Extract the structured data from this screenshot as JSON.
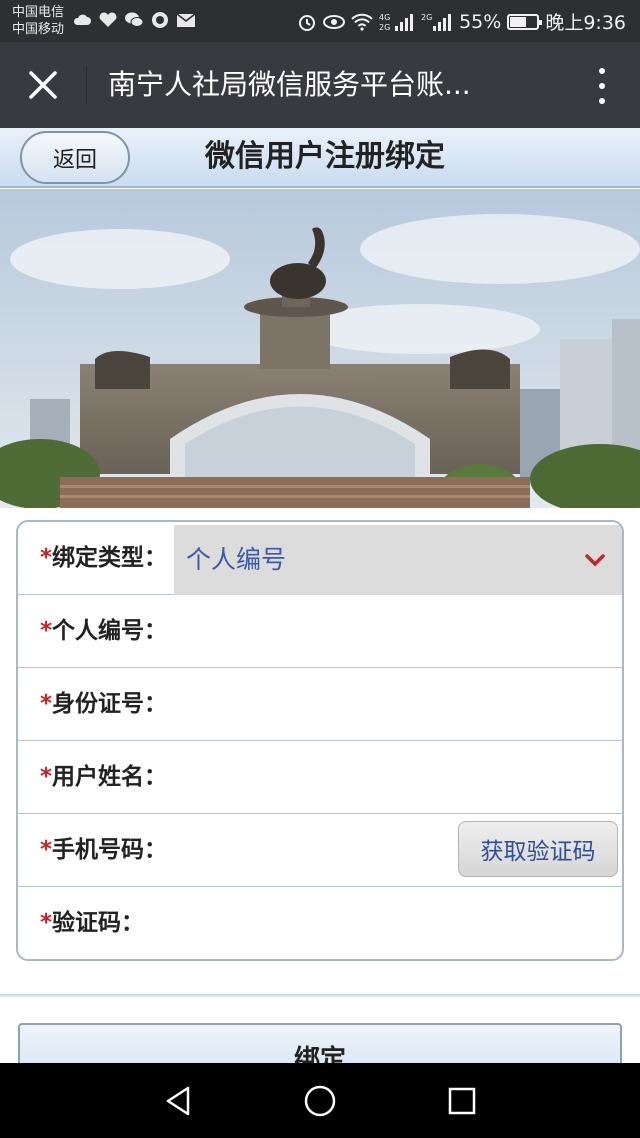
{
  "status_bar": {
    "carrier_1": "中国电信",
    "carrier_2": "中国移动",
    "battery_percent": "55%",
    "battery_level": 0.55,
    "time": "晚上9:36",
    "icons_left": [
      "cloud-icon",
      "health-icon",
      "wechat-icon",
      "chat-icon",
      "mail-icon"
    ],
    "icons_right": [
      "alarm-icon",
      "eye-icon",
      "wifi-icon",
      "signal-4g-icon",
      "signal-2g-icon",
      "battery-icon"
    ]
  },
  "title_bar": {
    "title": "南宁人社局微信服务平台账..."
  },
  "page_header": {
    "back_label": "返回",
    "title": "微信用户注册绑定"
  },
  "banner": {
    "subject": "elephant-monument-photo"
  },
  "form": {
    "required_mark": "*",
    "fields": [
      {
        "label": "绑定类型：",
        "type": "select",
        "value": "个人编号"
      },
      {
        "label": "个人编号：",
        "type": "text",
        "value": ""
      },
      {
        "label": "身份证号：",
        "type": "text",
        "value": ""
      },
      {
        "label": "用户姓名：",
        "type": "text",
        "value": ""
      },
      {
        "label": "手机号码：",
        "type": "text",
        "value": ""
      },
      {
        "label": "验证码：",
        "type": "text",
        "value": ""
      }
    ],
    "get_code_label": "获取验证码"
  },
  "bind_button": {
    "label": "绑定"
  },
  "colors": {
    "status_bar": "#2d2f33",
    "title_bar": "#393a3f",
    "required": "#d21c1c",
    "select_text": "#3c5aa8",
    "chevron": "#c0272d"
  }
}
